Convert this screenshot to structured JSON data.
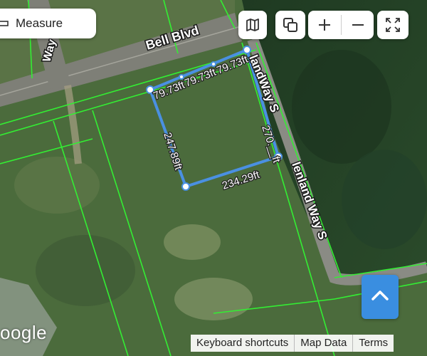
{
  "map": {
    "roads": {
      "main_road": "Bell Blvd",
      "side_road_upper": "landWay S",
      "side_road_lower": "lenland Way S",
      "road_top_left": "Way"
    },
    "measurements": {
      "top_edge": [
        "79.73ft",
        "79.73ft",
        "79.73ft"
      ],
      "left_edge": "247.89ft",
      "bottom_edge": "234.29ft",
      "right_edge": "270.__ft"
    },
    "logo": "oogle"
  },
  "controls": {
    "measure_label": "Measure",
    "layers_icon": "map-icon",
    "copy_icon": "copy-icon",
    "zoom_in_icon": "plus-icon",
    "zoom_out_icon": "minus-icon",
    "fullscreen_icon": "fullscreen-icon",
    "scroll_up_icon": "chevron-up-icon"
  },
  "attribution": {
    "shortcuts": "Keyboard shortcuts",
    "map_data": "Map Data",
    "terms": "Terms"
  },
  "colors": {
    "parcel_lines": "#33ee33",
    "measure_line": "#4a90e2",
    "up_button": "#3a8ee0"
  }
}
